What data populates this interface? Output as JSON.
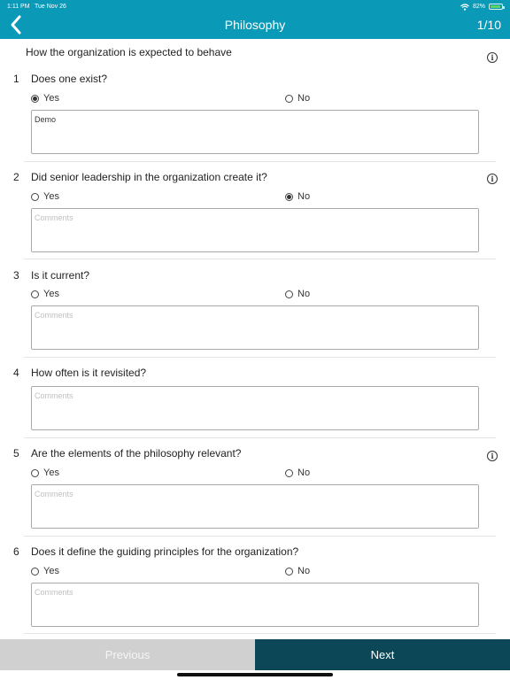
{
  "status_bar": {
    "time": "1:11 PM",
    "date": "Tue Nov 26",
    "battery_text": "82%",
    "battery_level": 0.82
  },
  "header": {
    "title": "Philosophy",
    "page_indicator": "1/10"
  },
  "section": {
    "title": "How the organization is expected to behave"
  },
  "questions": [
    {
      "number": "1",
      "text": "Does one exist?",
      "yes_label": "Yes",
      "no_label": "No",
      "selected": "yes",
      "comment": "Demo",
      "placeholder": "Comments"
    },
    {
      "number": "2",
      "text": "Did senior leadership in the organization create it?",
      "yes_label": "Yes",
      "no_label": "No",
      "selected": "no",
      "comment": "",
      "placeholder": "Comments"
    },
    {
      "number": "3",
      "text": "Is it current?",
      "yes_label": "Yes",
      "no_label": "No",
      "selected": "",
      "comment": "",
      "placeholder": "Comments"
    },
    {
      "number": "4",
      "text": "How often is it revisited?",
      "comment": "",
      "placeholder": "Comments"
    },
    {
      "number": "5",
      "text": "Are the elements of the philosophy relevant?",
      "yes_label": "Yes",
      "no_label": "No",
      "selected": "",
      "comment": "",
      "placeholder": "Comments"
    },
    {
      "number": "6",
      "text": "Does it define the guiding principles for the organization?",
      "yes_label": "Yes",
      "no_label": "No",
      "selected": "",
      "comment": "",
      "placeholder": "Comments"
    }
  ],
  "footer": {
    "previous_label": "Previous",
    "next_label": "Next"
  },
  "colors": {
    "header": "#0a9ab8",
    "next_button": "#0c4757",
    "previous_button": "#d0d0d0"
  }
}
